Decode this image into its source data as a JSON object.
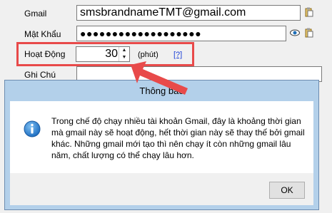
{
  "form": {
    "gmail_label": "Gmail",
    "gmail_value": "smsbrandnameTMT@gmail.com",
    "password_label": "Mật Khẩu",
    "password_value": "●●●●●●●●●●●●●●●●●●●",
    "active_label": "Hoạt Động",
    "active_value": "30",
    "active_unit": "(phút)",
    "help_link": "[?]",
    "note_label": "Ghi Chú"
  },
  "dialog": {
    "title": "Thông báo",
    "message": "Trong chế độ chạy nhiều tài khoản Gmail, đây là khoảng thời gian mà gmail này sẽ hoạt động, hết thời gian này sẽ thay thế bởi gmail khác. Những gmail mới tạo thì nên chạy ít còn những gmail lâu năm, chất lượng có thể chạy lâu hơn.",
    "ok_label": "OK",
    "icon": "info-icon"
  },
  "colors": {
    "highlight": "#e84a4a",
    "link": "#1a3fd6",
    "dialog_frame": "#b3d0ea"
  }
}
